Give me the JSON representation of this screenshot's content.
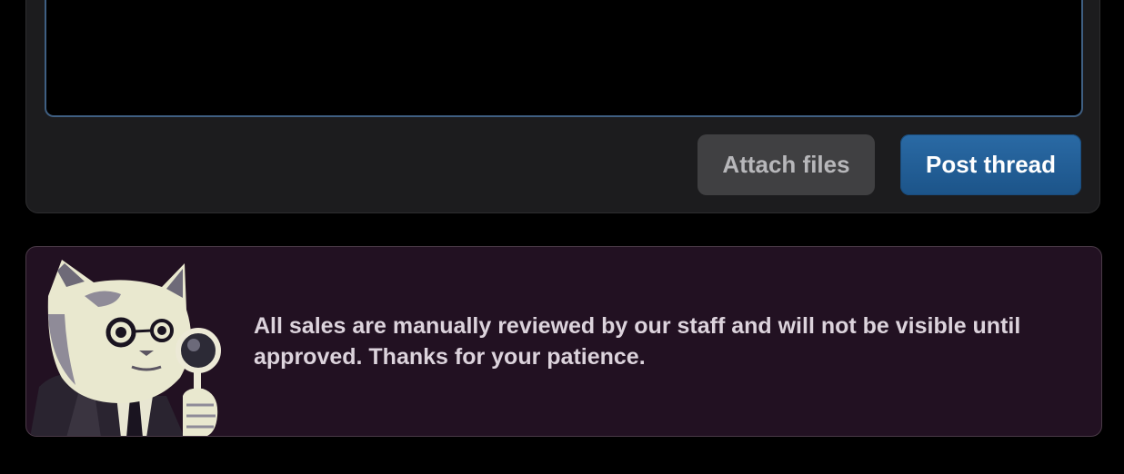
{
  "composer": {
    "textarea_value": "",
    "attach_label": "Attach files",
    "post_label": "Post thread"
  },
  "notice": {
    "mascot_icon": "detective-cat-with-magnifying-glass-icon",
    "message": "All sales are manually reviewed by our staff and will not be visible until approved. Thanks for your patience."
  },
  "colors": {
    "page_bg": "#000000",
    "card_bg": "#1c1c1e",
    "textarea_border": "#3f5f82",
    "post_button": "#1f5c94",
    "attach_button": "#404042",
    "notice_bg": "#221122",
    "notice_text": "#dcd3dc"
  }
}
